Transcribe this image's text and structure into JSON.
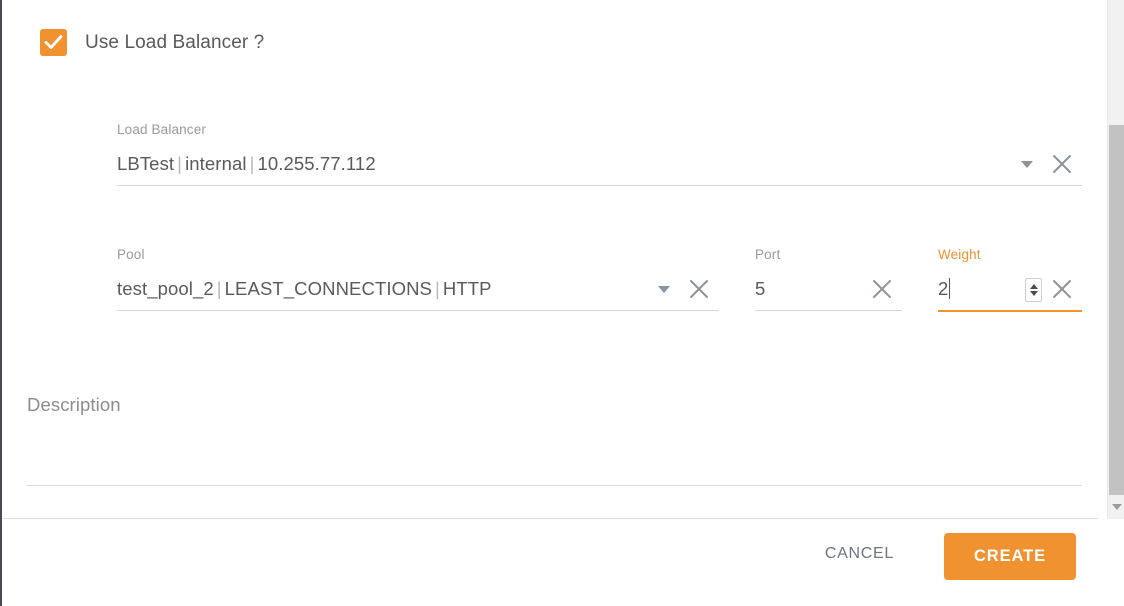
{
  "theme": {
    "accent": "#F0922F",
    "text_primary": "#5a5a5a",
    "text_muted": "#9a9a9a",
    "underline": "#d7d7d7"
  },
  "load_balancer_toggle": {
    "label": "Use Load Balancer ?",
    "checked": true,
    "icon": "check-icon"
  },
  "fields": {
    "load_balancer": {
      "label": "Load Balancer",
      "value_parts": [
        "LBTest",
        "internal",
        "10.255.77.112"
      ],
      "value": "LBTest | internal | 10.255.77.112",
      "dropdown_icon": "chevron-down-icon",
      "clear_icon": "close-icon",
      "focused": false
    },
    "pool": {
      "label": "Pool",
      "value_parts": [
        "test_pool_2",
        "LEAST_CONNECTIONS",
        "HTTP"
      ],
      "value": "test_pool_2 | LEAST_CONNECTIONS | HTTP",
      "dropdown_icon": "chevron-down-icon",
      "clear_icon": "close-icon",
      "focused": false
    },
    "port": {
      "label": "Port",
      "value": "5",
      "clear_icon": "close-icon",
      "focused": false
    },
    "weight": {
      "label": "Weight",
      "value": "2",
      "spinner_icon": "number-stepper-icon",
      "clear_icon": "close-icon",
      "focused": true
    },
    "description": {
      "label": "Description",
      "value": "",
      "placeholder": "Description"
    }
  },
  "footer": {
    "cancel_label": "CANCEL",
    "create_label": "CREATE"
  },
  "scrollbar": {
    "down_arrow_icon": "chevron-down-icon"
  }
}
